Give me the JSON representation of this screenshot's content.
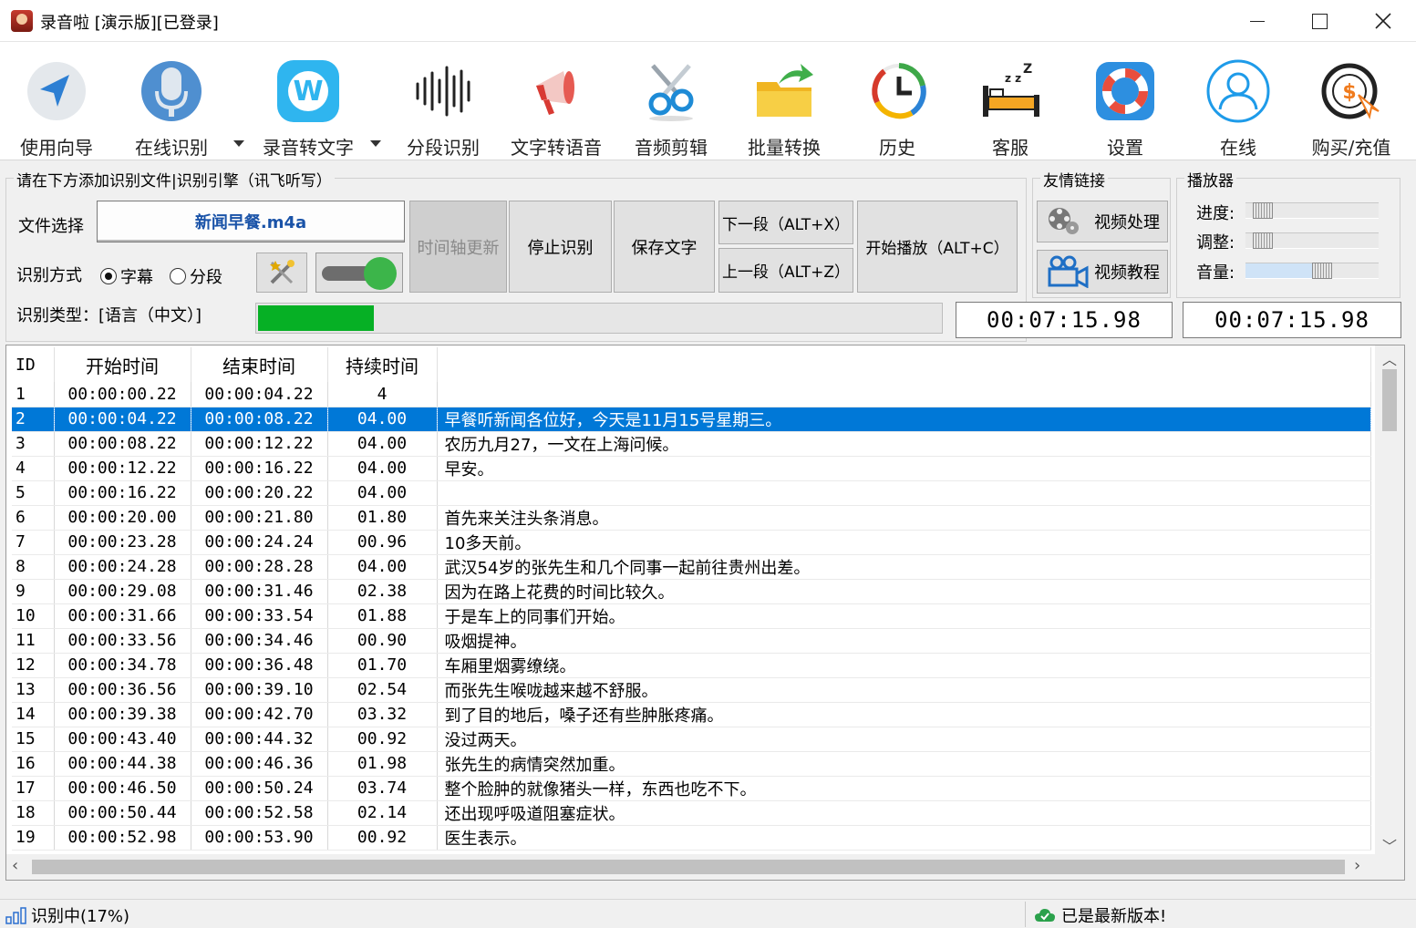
{
  "window": {
    "title": "录音啦 [演示版][已登录]"
  },
  "toolbar": {
    "items": [
      {
        "label": "使用向导"
      },
      {
        "label": "在线识别"
      },
      {
        "label": "录音转文字"
      },
      {
        "label": "分段识别"
      },
      {
        "label": "文字转语音"
      },
      {
        "label": "音频剪辑"
      },
      {
        "label": "批量转换"
      },
      {
        "label": "历史"
      },
      {
        "label": "客服"
      },
      {
        "label": "设置"
      },
      {
        "label": "在线"
      },
      {
        "label": "购买/充值"
      }
    ]
  },
  "recognize": {
    "group_title": "请在下方添加识别文件|识别引擎（讯飞听写）",
    "file_label": "文件选择",
    "file_name": "新闻早餐.m4a",
    "mode_label": "识别方式",
    "mode_subtitle": "字幕",
    "mode_segment": "分段",
    "mode_selected": "字幕",
    "type_label": "识别类型：[语言（中文）]",
    "btn_timeline": "时间轴更新",
    "btn_stop": "停止识别",
    "btn_save": "保存文字",
    "btn_next": "下一段（ALT+X）",
    "btn_prev": "上一段（ALT+Z）",
    "btn_play": "开始播放（ALT+C）",
    "progress_percent": 17,
    "time_left": "00:07:15.98",
    "time_right": "00:07:15.98"
  },
  "links": {
    "group_title": "友情链接",
    "video_process": "视频处理",
    "video_tutorial": "视频教程"
  },
  "player": {
    "group_title": "播放器",
    "progress_label": "进度:",
    "adjust_label": "调整:",
    "volume_label": "音量:",
    "progress_value": 0,
    "adjust_value": 0,
    "volume_value": 0.6
  },
  "table": {
    "headers": [
      "ID",
      "开始时间",
      "结束时间",
      "持续时间",
      ""
    ],
    "selected_row": 2,
    "rows": [
      [
        "1",
        "00:00:00.22",
        "00:00:04.22",
        "4",
        ""
      ],
      [
        "2",
        "00:00:04.22",
        "00:00:08.22",
        "04.00",
        "早餐听新闻各位好，今天是11月15号星期三。"
      ],
      [
        "3",
        "00:00:08.22",
        "00:00:12.22",
        "04.00",
        "农历九月27，一文在上海问候。"
      ],
      [
        "4",
        "00:00:12.22",
        "00:00:16.22",
        "04.00",
        "早安。"
      ],
      [
        "5",
        "00:00:16.22",
        "00:00:20.22",
        "04.00",
        ""
      ],
      [
        "6",
        "00:00:20.00",
        "00:00:21.80",
        "01.80",
        "首先来关注头条消息。"
      ],
      [
        "7",
        "00:00:23.28",
        "00:00:24.24",
        "00.96",
        "10多天前。"
      ],
      [
        "8",
        "00:00:24.28",
        "00:00:28.28",
        "04.00",
        "武汉54岁的张先生和几个同事一起前往贵州出差。"
      ],
      [
        "9",
        "00:00:29.08",
        "00:00:31.46",
        "02.38",
        "因为在路上花费的时间比较久。"
      ],
      [
        "10",
        "00:00:31.66",
        "00:00:33.54",
        "01.88",
        "于是车上的同事们开始。"
      ],
      [
        "11",
        "00:00:33.56",
        "00:00:34.46",
        "00.90",
        "吸烟提神。"
      ],
      [
        "12",
        "00:00:34.78",
        "00:00:36.48",
        "01.70",
        "车厢里烟雾缭绕。"
      ],
      [
        "13",
        "00:00:36.56",
        "00:00:39.10",
        "02.54",
        "而张先生喉咙越来越不舒服。"
      ],
      [
        "14",
        "00:00:39.38",
        "00:00:42.70",
        "03.32",
        "到了目的地后，嗓子还有些肿胀疼痛。"
      ],
      [
        "15",
        "00:00:43.40",
        "00:00:44.32",
        "00.92",
        "没过两天。"
      ],
      [
        "16",
        "00:00:44.38",
        "00:00:46.36",
        "01.98",
        "张先生的病情突然加重。"
      ],
      [
        "17",
        "00:00:46.50",
        "00:00:50.24",
        "03.74",
        "整个脸肿的就像猪头一样，东西也吃不下。"
      ],
      [
        "18",
        "00:00:50.44",
        "00:00:52.58",
        "02.14",
        "还出现呼吸道阻塞症状。"
      ],
      [
        "19",
        "00:00:52.98",
        "00:00:53.90",
        "00.92",
        "医生表示。"
      ]
    ]
  },
  "status": {
    "left": "识别中(17%)",
    "right": "已是最新版本!"
  }
}
